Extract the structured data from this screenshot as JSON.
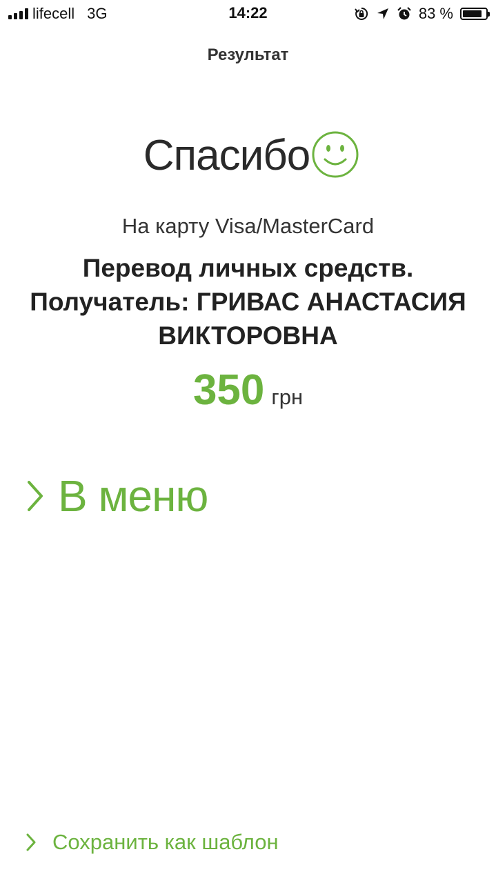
{
  "status_bar": {
    "carrier": "lifecell",
    "network": "3G",
    "time": "14:22",
    "battery_text": "83 %",
    "battery_level": 0.83,
    "icons": [
      "signal-icon",
      "orientation-lock-icon",
      "location-arrow-icon",
      "alarm-icon",
      "battery-icon"
    ]
  },
  "header": {
    "title": "Результат"
  },
  "result": {
    "thanks": "Спасибо",
    "subtitle": "На карту Visa/MasterCard",
    "purpose": "Перевод личных средств. Получатель: ГРИВАС АНАСТАСИЯ ВИКТОРОВНА",
    "amount": "350",
    "currency": "грн"
  },
  "actions": {
    "menu_label": "В меню",
    "save_template_label": "Сохранить как шаблон"
  },
  "colors": {
    "accent": "#6cb33f",
    "text": "#222222",
    "background": "#ffffff"
  }
}
